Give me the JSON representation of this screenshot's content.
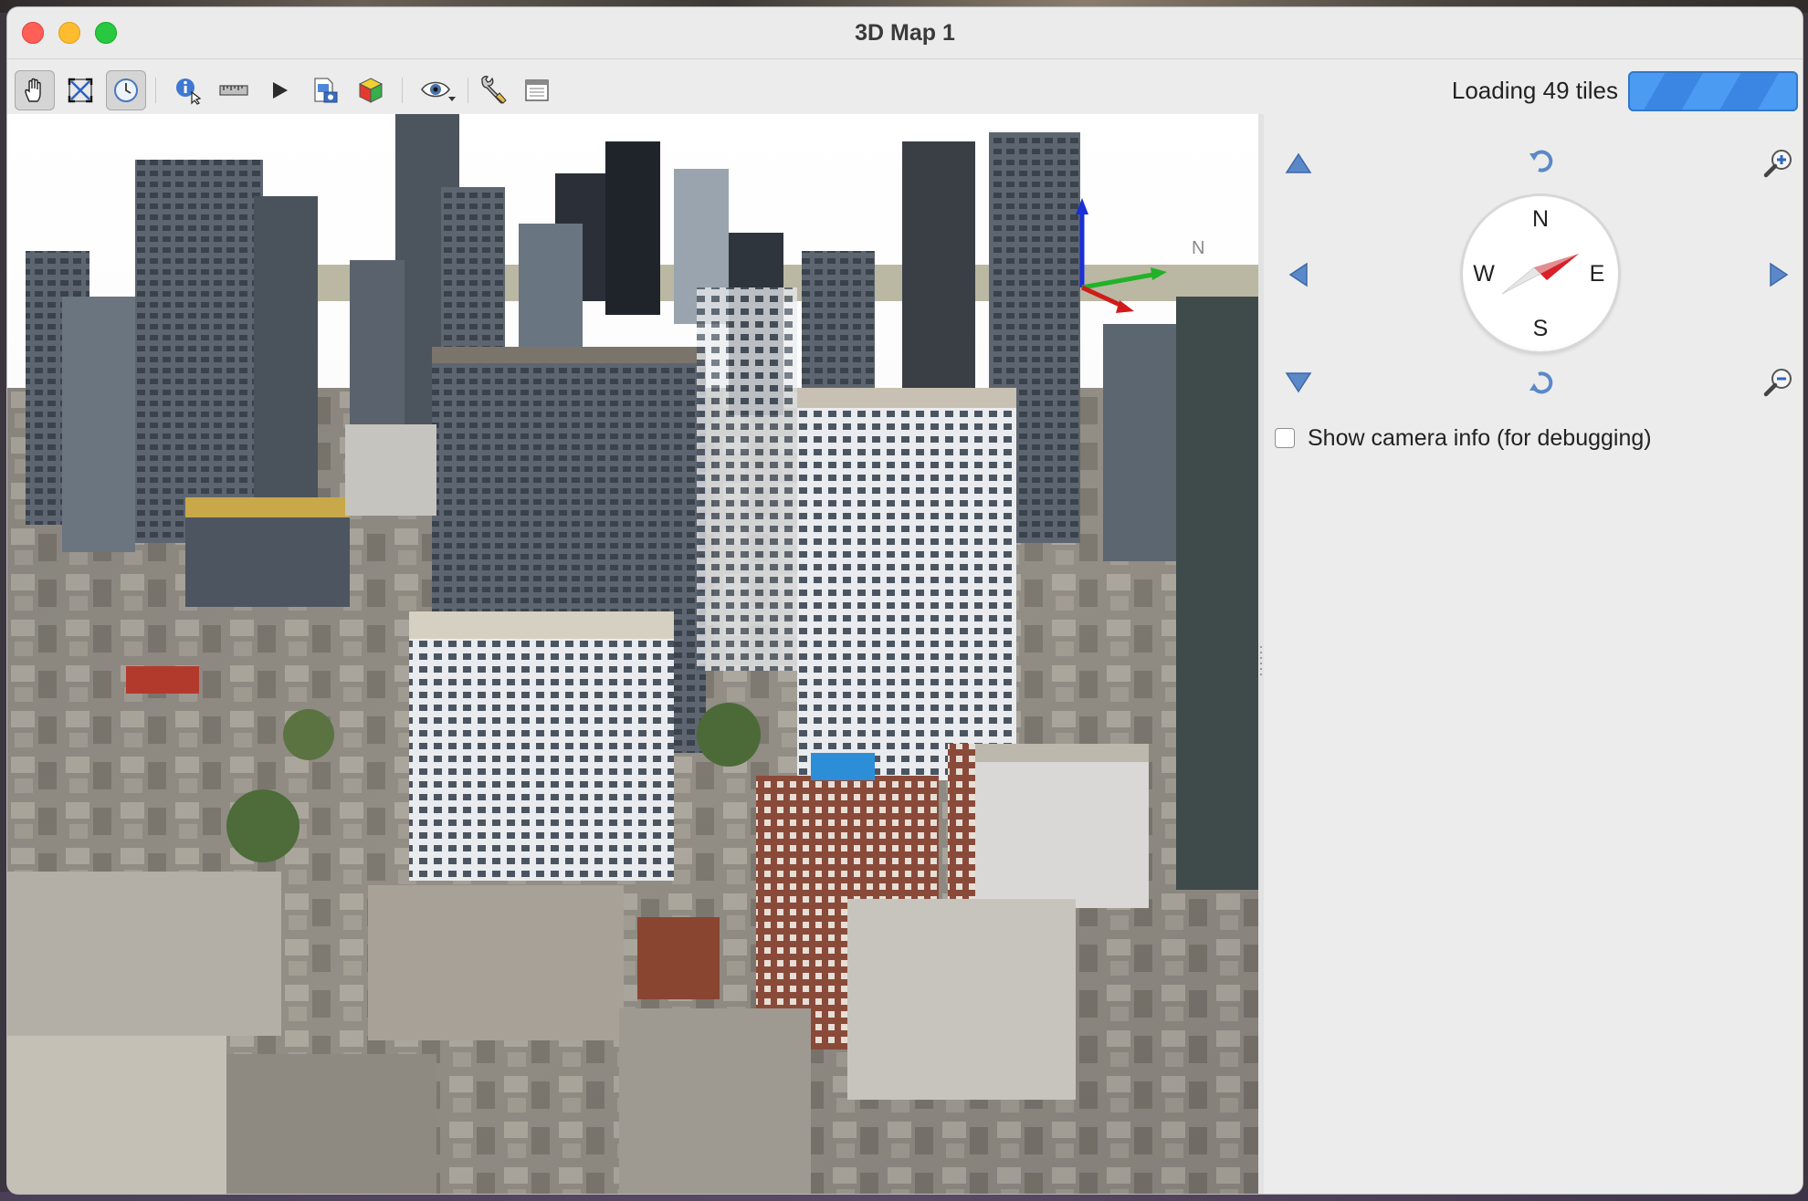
{
  "window": {
    "title": "3D Map 1"
  },
  "toolbar": {
    "items": [
      {
        "name": "pan-tool",
        "icon": "hand-icon",
        "active": true
      },
      {
        "name": "zoom-full",
        "icon": "zoom-full-icon",
        "active": false
      },
      {
        "name": "camera-control",
        "icon": "camera-orbit-icon",
        "active": true
      },
      {
        "name": "identify",
        "icon": "identify-icon",
        "active": false
      },
      {
        "name": "measure-line",
        "icon": "ruler-icon",
        "active": false
      },
      {
        "name": "animation",
        "icon": "play-icon",
        "active": false
      },
      {
        "name": "export-scene",
        "icon": "export-scene-icon",
        "active": false
      },
      {
        "name": "shading",
        "icon": "cube-icon",
        "active": false
      },
      {
        "name": "view-options",
        "icon": "eye-icon",
        "active": false
      },
      {
        "name": "configure",
        "icon": "wrench-icon",
        "active": false
      },
      {
        "name": "panels",
        "icon": "window-icon",
        "active": false
      }
    ],
    "status": "Loading 49 tiles",
    "progress_color": "#4c9bf2"
  },
  "axis_gizmo": {
    "north_label": "N"
  },
  "navigation": {
    "compass": {
      "n": "N",
      "e": "E",
      "s": "S",
      "w": "W"
    },
    "show_camera_info": {
      "label": "Show camera info (for debugging)",
      "checked": false
    }
  },
  "colors": {
    "nav_arrow": "#5b88c8",
    "compass_needle": "#e8232b"
  }
}
